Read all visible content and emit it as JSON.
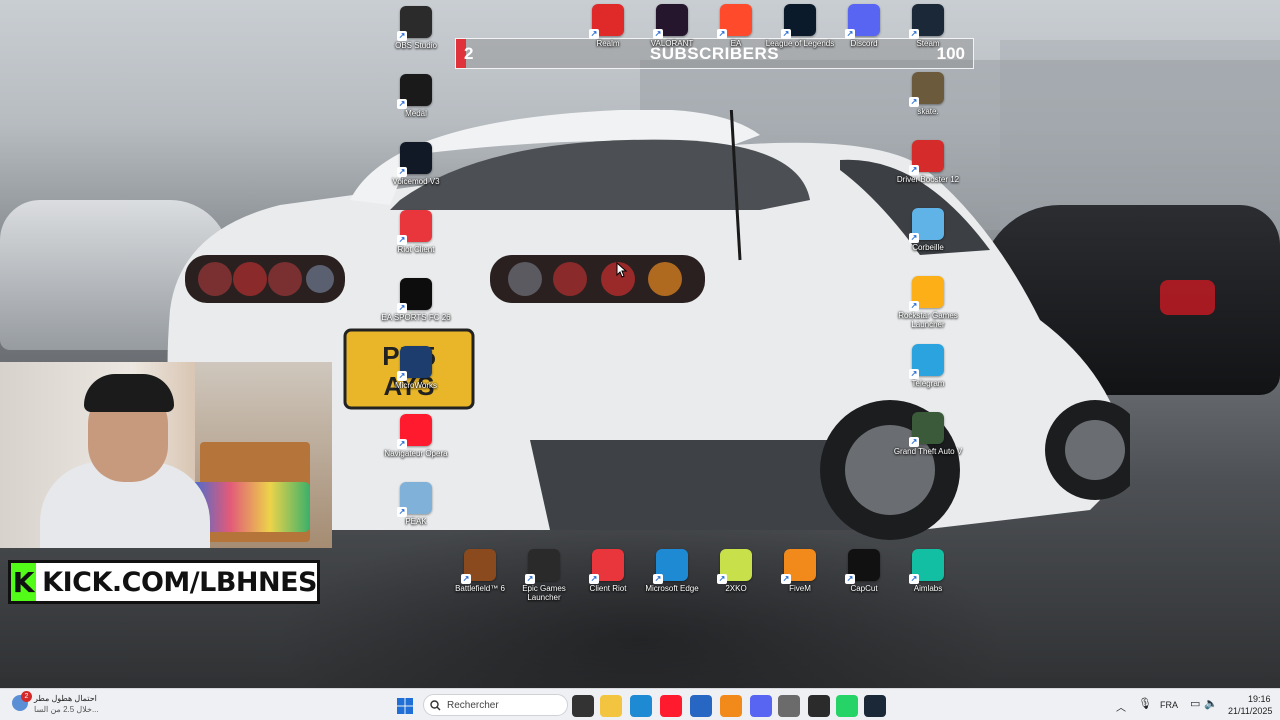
{
  "desktop": {
    "icons_left_column": [
      {
        "id": "obs",
        "label": "OBS Studio",
        "icon": "obs-icon",
        "color": "#2b2b2b"
      },
      {
        "id": "medal",
        "label": "Medal",
        "icon": "medal-icon",
        "color": "#1a1a1a"
      },
      {
        "id": "voicemod",
        "label": "Voicemod V3",
        "icon": "voicemod-icon",
        "color": "#111826"
      },
      {
        "id": "riot",
        "label": "Riot Client",
        "icon": "riot-fist-icon",
        "color": "#e8363c"
      },
      {
        "id": "fc26",
        "label": "EA SPORTS FC 26",
        "icon": "fc26-icon",
        "color": "#0d0d0d"
      },
      {
        "id": "microworks",
        "label": "MicroWorks",
        "icon": "microworks-icon",
        "color": "#1c3d6e"
      },
      {
        "id": "opera",
        "label": "Navigateur Opera",
        "icon": "opera-icon",
        "color": "#ff1b2d"
      },
      {
        "id": "peak",
        "label": "PEAK",
        "icon": "peak-icon",
        "color": "#7fb1d9"
      }
    ],
    "icons_top_row": [
      {
        "id": "realm",
        "label": "Realm",
        "icon": "realm-icon",
        "color": "#e02a2a"
      },
      {
        "id": "valorant",
        "label": "VALORANT",
        "icon": "valorant-icon",
        "color": "#25162e"
      },
      {
        "id": "ea",
        "label": "EA",
        "icon": "ea-icon",
        "color": "#ff4b2b"
      },
      {
        "id": "lol",
        "label": "League of Legends",
        "icon": "lol-icon",
        "color": "#0b1a2a"
      },
      {
        "id": "discord",
        "label": "Discord",
        "icon": "discord-icon",
        "color": "#5865f2"
      },
      {
        "id": "steam",
        "label": "Steam",
        "icon": "steam-icon",
        "color": "#1b2838"
      }
    ],
    "icons_right_column": [
      {
        "id": "skate",
        "label": "skate.",
        "icon": "skate-icon",
        "color": "#6b5a3c"
      },
      {
        "id": "driverbooster",
        "label": "Driver Booster 12",
        "icon": "driver-booster-icon",
        "color": "#d62b2b"
      },
      {
        "id": "corbeille",
        "label": "Corbeille",
        "icon": "recycle-bin-icon",
        "color": "#5fb3e6"
      },
      {
        "id": "rockstar",
        "label": "Rockstar Games Launcher",
        "icon": "rockstar-icon",
        "color": "#fcaf17"
      },
      {
        "id": "telegram",
        "label": "Telegram",
        "icon": "telegram-icon",
        "color": "#2aa3df"
      },
      {
        "id": "gta",
        "label": "Grand Theft Auto V",
        "icon": "gta-icon",
        "color": "#3b5a3a"
      }
    ],
    "icons_bottom_row": [
      {
        "id": "bf6",
        "label": "Battlefield™ 6",
        "icon": "battlefield-icon",
        "color": "#8a4a1e"
      },
      {
        "id": "epic",
        "label": "Epic Games Launcher",
        "icon": "epic-games-icon",
        "color": "#2a2a2a"
      },
      {
        "id": "clientriot",
        "label": "Client Riot",
        "icon": "riot-fist-icon",
        "color": "#e8363c"
      },
      {
        "id": "edge",
        "label": "Microsoft Edge",
        "icon": "edge-icon",
        "color": "#1f8ad4"
      },
      {
        "id": "2xko",
        "label": "2XKO",
        "icon": "2xko-icon",
        "color": "#c8e14b"
      },
      {
        "id": "fivem",
        "label": "FiveM",
        "icon": "fivem-icon",
        "color": "#f28a1b"
      },
      {
        "id": "capcut",
        "label": "CapCut",
        "icon": "capcut-icon",
        "color": "#111111"
      },
      {
        "id": "aimlabs",
        "label": "Aimlabs",
        "icon": "aimlabs-icon",
        "color": "#12bfa3"
      }
    ]
  },
  "subscriber_goal": {
    "current": "2",
    "title": "SUBSCRIBERS",
    "goal": "100",
    "progress_fraction": 0.02,
    "accent": "#e0323a"
  },
  "overlay": {
    "kick_text": "KICK.COM/LBHNES",
    "kick_logo_letter": "K",
    "kick_color": "#53fc18"
  },
  "taskbar": {
    "weather_line1": "احتمال هطول مطر",
    "weather_line2": "خلال 2.5 من السا...",
    "weather_badge": "2",
    "search_placeholder": "Rechercher",
    "language": "FRA",
    "time": "19:16",
    "date": "21/11/2025",
    "pinned": [
      {
        "icon": "windows-start-icon",
        "color": "#1f6fd6"
      },
      {
        "icon": "task-view-icon",
        "color": "#333333"
      },
      {
        "icon": "file-explorer-icon",
        "color": "#f3c440"
      },
      {
        "icon": "edge-icon",
        "color": "#1f8ad4"
      },
      {
        "icon": "opera-icon",
        "color": "#ff1b2d"
      },
      {
        "icon": "store-icon",
        "color": "#2766c2"
      },
      {
        "icon": "app-icon",
        "color": "#f28a1b"
      },
      {
        "icon": "discord-icon",
        "color": "#5865f2"
      },
      {
        "icon": "settings-icon",
        "color": "#6b6b6b"
      },
      {
        "icon": "obs-icon",
        "color": "#2b2b2b"
      },
      {
        "icon": "whatsapp-icon",
        "color": "#25d366"
      },
      {
        "icon": "steam-icon",
        "color": "#1b2838"
      }
    ]
  }
}
